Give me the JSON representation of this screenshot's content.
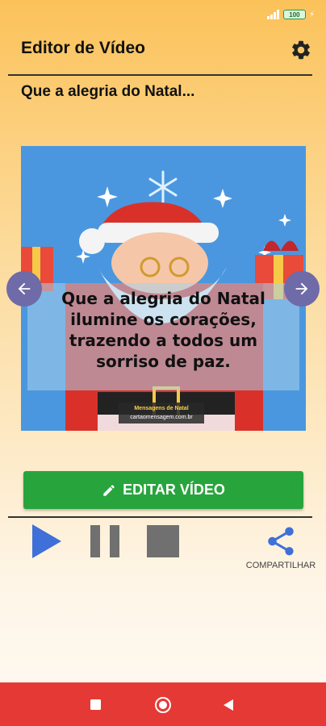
{
  "status_bar": {
    "battery": "100"
  },
  "header": {
    "title": "Editor de Vídeo",
    "settings_icon": "gear-icon"
  },
  "subtitle": "Que a alegria do Natal...",
  "preview": {
    "caption": "Que a alegria do Natal ilumine os corações, trazendo a todos um sorriso de paz.",
    "watermark_title": "Mensagens de Natal",
    "watermark_site": "cartaomensagem.com.br"
  },
  "edit_button": {
    "label": "EDITAR VÍDEO",
    "icon": "edit-icon"
  },
  "player": {
    "share_label": "COMPARTILHAR"
  },
  "colors": {
    "accent_green": "#28a43d",
    "player_blue": "#3f6fd8",
    "nav_red": "#e53935",
    "arrow_purple": "#6f6aa8"
  }
}
